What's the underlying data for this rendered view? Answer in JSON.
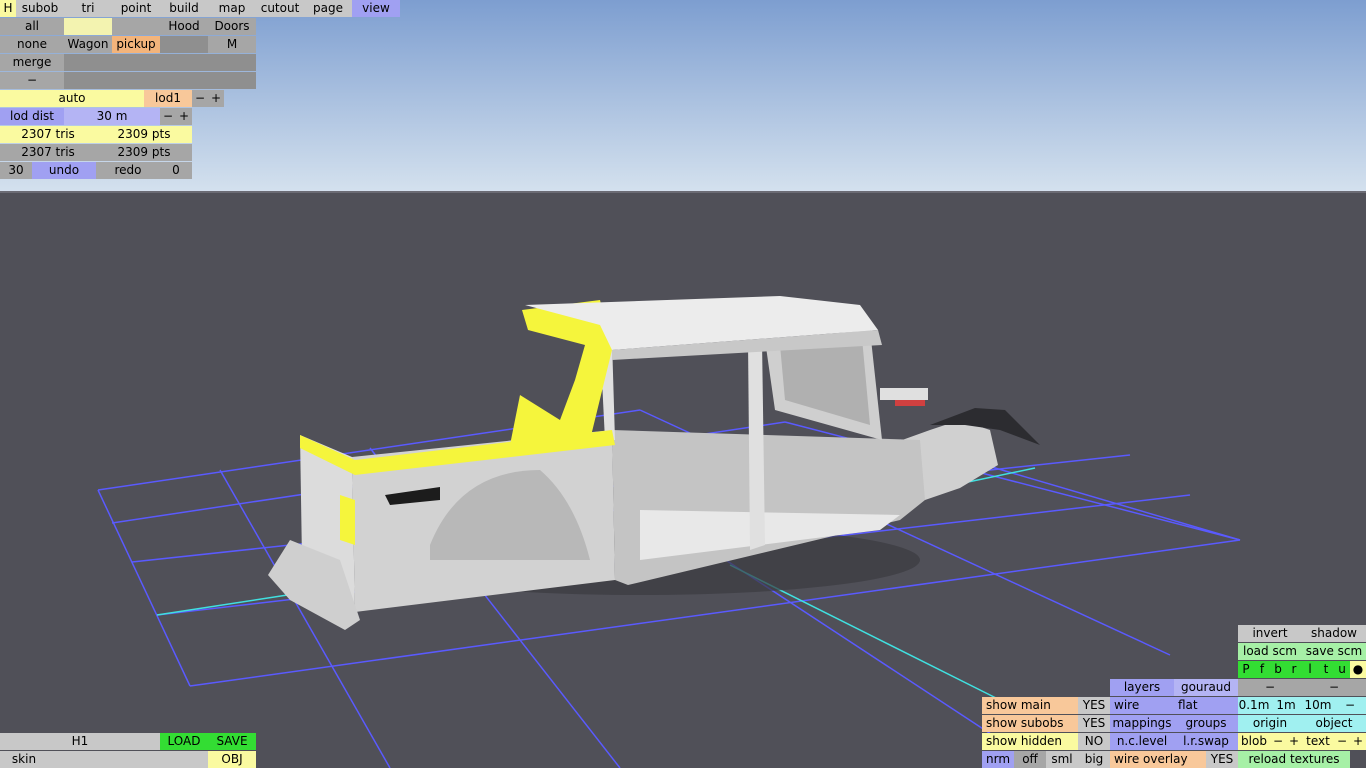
{
  "menu": {
    "h": "H",
    "tabs": [
      "subob",
      "tri",
      "point",
      "build",
      "map",
      "cutout",
      "page",
      "view"
    ]
  },
  "sel": {
    "all": "all",
    "none": "none",
    "merge": "merge",
    "minus": "−",
    "wagon": "Wagon",
    "pickup": "pickup",
    "hood": "Hood",
    "doors": "Doors",
    "m": "M"
  },
  "lod": {
    "auto": "auto",
    "lod1": "lod1",
    "minus": "−",
    "plus": "+",
    "dist_label": "lod dist",
    "dist_value": "30 m"
  },
  "stats": {
    "tris1": "2307 tris",
    "pts1": "2309 pts",
    "tris2": "2307 tris",
    "pts2": "2309 pts"
  },
  "hist": {
    "count": "30",
    "undo": "undo",
    "redo": "redo",
    "redo_count": "0"
  },
  "file": {
    "name": "H1",
    "load": "LOAD",
    "save": "SAVE",
    "skin": "skin",
    "obj": "OBJ"
  },
  "rp": {
    "invert": "invert",
    "shadow": "shadow",
    "load_scm": "load scm",
    "save_scm": "save scm",
    "letters": [
      "P",
      "f",
      "b",
      "r",
      "l",
      "t",
      "u",
      "●"
    ],
    "layers": "layers",
    "gouraud": "gouraud",
    "dash": "−",
    "show_main": "show main",
    "show_main_val": "YES",
    "wire": "wire",
    "flat": "flat",
    "s01": "0.1m",
    "s1": "1m",
    "s10": "10m",
    "sminus": "−",
    "show_subobs": "show subobs",
    "show_subobs_val": "YES",
    "mappings": "mappings",
    "groups": "groups",
    "origin": "origin",
    "object": "object",
    "show_hidden": "show hidden",
    "show_hidden_val": "NO",
    "nc_level": "n.c.level",
    "lr_swap": "l.r.swap",
    "blob": "blob",
    "text": "text",
    "minus": "−",
    "plus": "+",
    "nrm": "nrm",
    "off": "off",
    "sml": "sml",
    "big": "big",
    "wire_overlay": "wire overlay",
    "wire_overlay_val": "YES",
    "reload": "reload textures"
  },
  "colors": {
    "sky_top": "#7d9ed0",
    "sky_bottom": "#d4e1ee",
    "ground": "#505058",
    "grid": "#5a5aff",
    "axis": "#40e0e0",
    "selection": "#f5f53c",
    "body": "#d8d8d8"
  }
}
